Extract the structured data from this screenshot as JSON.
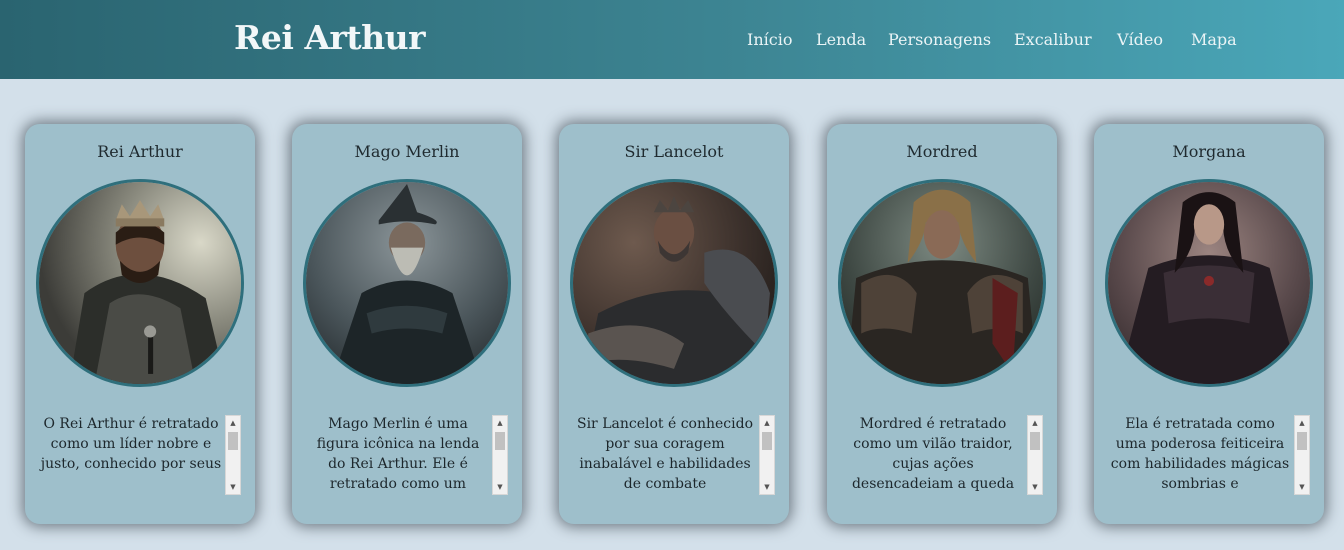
{
  "header": {
    "title": "Rei Arthur",
    "nav": [
      "Início",
      "Lenda",
      "Personagens",
      "Excalibur",
      "Vídeo",
      "Mapa"
    ]
  },
  "colors": {
    "header_start": "#2a6470",
    "header_end": "#4aa7b9",
    "background": "#d3e0ea",
    "card": "#9ebfcb",
    "portrait_border": "#2f6f7c"
  },
  "cards": [
    {
      "name": "Rei Arthur",
      "portrait": "king-arthur-portrait",
      "description": "O Rei Arthur é retratado como um líder nobre e justo, conhecido por seus"
    },
    {
      "name": "Mago Merlin",
      "portrait": "merlin-portrait",
      "description": "Mago Merlin é uma figura icônica na lenda do Rei Arthur. Ele é retratado como um"
    },
    {
      "name": "Sir Lancelot",
      "portrait": "lancelot-portrait",
      "description": "Sir Lancelot é conhecido por sua coragem inabalável e habilidades de combate"
    },
    {
      "name": "Mordred",
      "portrait": "mordred-portrait",
      "description": "Mordred é retratado como um vilão traidor, cujas ações desencadeiam a queda"
    },
    {
      "name": "Morgana",
      "portrait": "morgana-portrait",
      "description": "Ela é retratada como uma poderosa feiticeira com habilidades mágicas sombrias e"
    }
  ]
}
